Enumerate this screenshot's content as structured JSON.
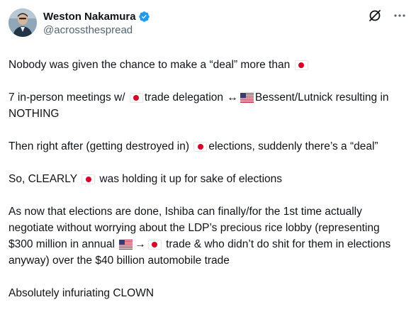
{
  "author": {
    "display_name": "Weston Nakamura",
    "handle": "@acrossthespread",
    "verified": true
  },
  "icons": {
    "avatar": "avatar-photo",
    "verified": "verified-badge-icon",
    "grok": "grok-icon",
    "more": "more-icon",
    "flag_japan": "japan-flag-icon",
    "flag_usa": "usa-flag-icon"
  },
  "colors": {
    "text": "#0f1419",
    "secondary": "#536471",
    "verified": "#1d9bf0",
    "japan_red": "#d80027"
  },
  "tweet": {
    "p1": [
      "Nobody was given the chance to make a “deal” more than",
      ""
    ],
    "p2": [
      "7 in-person meetings w/",
      "trade delegation",
      "↔",
      "Bessent/Lutnick resulting in NOTHING"
    ],
    "p3": [
      "Then right after (getting destroyed in)",
      "elections, suddenly there’s a “deal”"
    ],
    "p4": [
      "So, CLEARLY",
      "was holding it up for sake of elections"
    ],
    "p5": [
      "As now that elections are done, Ishiba can finally/for the 1st time actually negotiate without worrying about the LDP’s precious rice lobby (representing $300 million in annual",
      "→",
      "trade & who didn’t do shit for them in elections anyway) over the $40 billion  automobile trade"
    ],
    "p6": "Absolutely infuriating CLOWN"
  }
}
